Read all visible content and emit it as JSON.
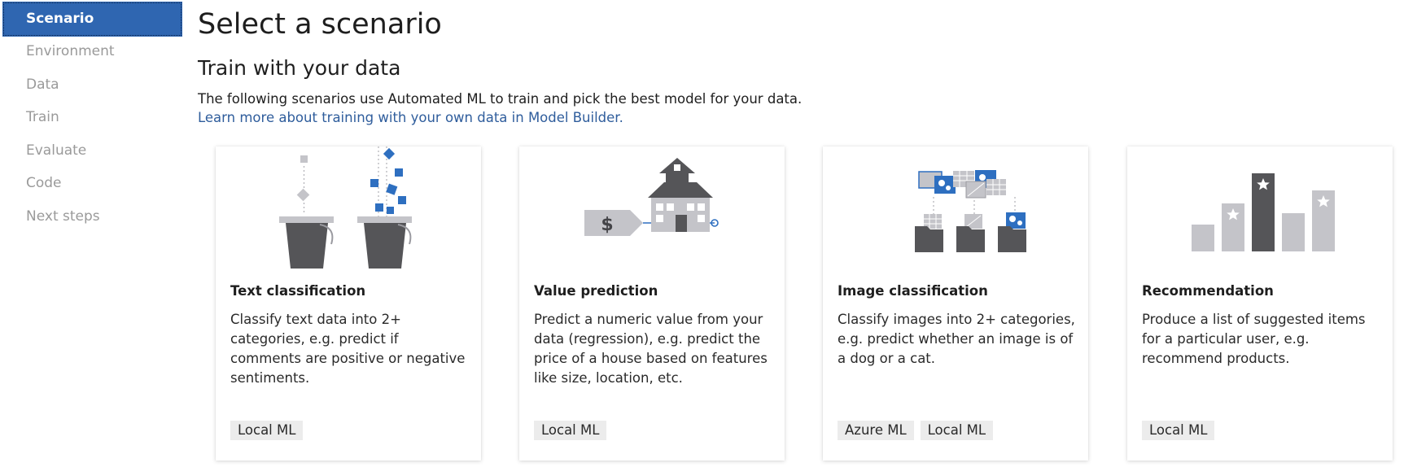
{
  "sidebar": {
    "items": [
      {
        "label": "Scenario"
      },
      {
        "label": "Environment"
      },
      {
        "label": "Data"
      },
      {
        "label": "Train"
      },
      {
        "label": "Evaluate"
      },
      {
        "label": "Code"
      },
      {
        "label": "Next steps"
      }
    ]
  },
  "main": {
    "title": "Select a scenario",
    "section_title": "Train with your data",
    "description": "The following scenarios use Automated ML to train and pick the best model for your data.",
    "learn_more_link": "Learn more about training with your own data in Model Builder."
  },
  "cards": [
    {
      "title": "Text classification",
      "description": "Classify text data into 2+ categories, e.g. predict if comments are positive or negative sentiments.",
      "tags": [
        "Local ML"
      ],
      "icon": "buckets-icon"
    },
    {
      "title": "Value prediction",
      "description": "Predict a numeric value from your data (regression), e.g. predict the price of a house based on features like size, location, etc.",
      "tags": [
        "Local ML"
      ],
      "icon": "house-price-tag-icon",
      "price_symbol": "$"
    },
    {
      "title": "Image classification",
      "description": "Classify images into 2+ categories, e.g. predict whether an image is of a dog or a cat.",
      "tags": [
        "Azure ML",
        "Local ML"
      ],
      "icon": "image-folders-icon"
    },
    {
      "title": "Recommendation",
      "description": "Produce a list of suggested items for a particular user, e.g. recommend products.",
      "tags": [
        "Local ML"
      ],
      "icon": "star-bars-icon"
    }
  ],
  "colors": {
    "accent": "#2f66b1",
    "link": "#2f5d9c",
    "icon_dark": "#555558",
    "icon_light": "#c4c4c9",
    "icon_blue": "#2e6fc0"
  }
}
